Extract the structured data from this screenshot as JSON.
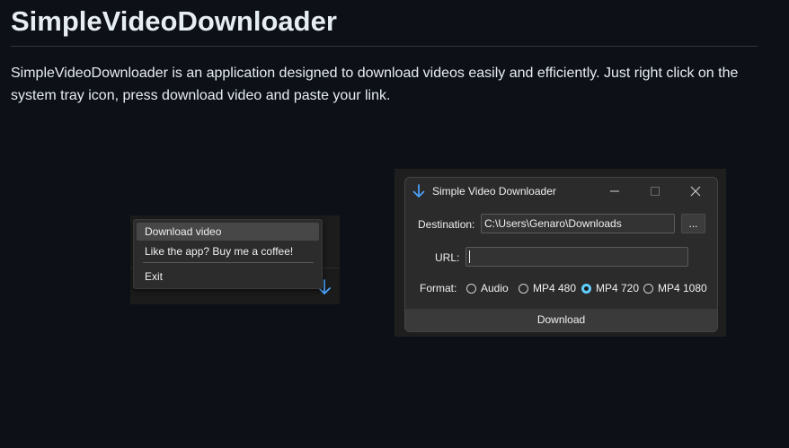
{
  "page": {
    "title": "SimpleVideoDownloader",
    "description": "SimpleVideoDownloader is an application designed to download videos easily and efficiently. Just right click on the system tray icon, press download video and paste your link."
  },
  "tray": {
    "menu_items": [
      {
        "label": "Download video",
        "highlighted": true
      },
      {
        "label": "Like the app? Buy me a coffee!",
        "highlighted": false
      },
      {
        "label": "Exit",
        "highlighted": false
      }
    ],
    "caret_glyph": "^",
    "arrow_icon": "download-arrow-icon"
  },
  "window": {
    "title": "Simple Video Downloader",
    "minimize_glyph": "—",
    "maximize_glyph": "☐",
    "close_glyph": "✕",
    "destination_label": "Destination:",
    "destination_value": "C:\\Users\\Genaro\\Downloads",
    "browse_label": "...",
    "url_label": "URL:",
    "url_value": "",
    "format_label": "Format:",
    "formats": [
      {
        "label": "Audio",
        "selected": false
      },
      {
        "label": "MP4 480",
        "selected": false
      },
      {
        "label": "MP4 720",
        "selected": true
      },
      {
        "label": "MP4 1080",
        "selected": false
      }
    ],
    "download_label": "Download"
  },
  "colors": {
    "background": "#0d1117",
    "accent": "#60cdff",
    "icon_blue": "#4aa3ff"
  }
}
